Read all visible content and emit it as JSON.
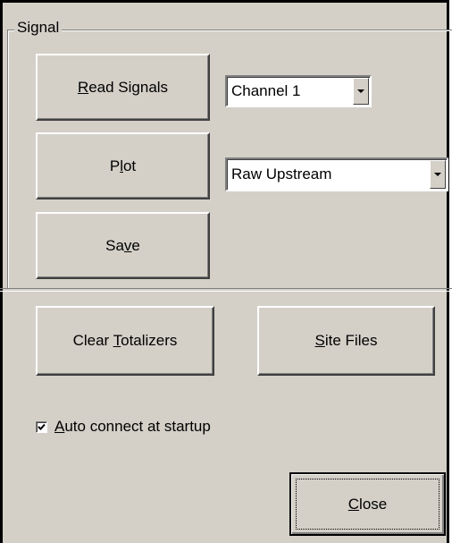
{
  "group": {
    "title": "Signal"
  },
  "buttons": {
    "read_signals": {
      "pre": "",
      "key": "R",
      "post": "ead Signals"
    },
    "plot": {
      "pre": "P",
      "key": "l",
      "post": "ot"
    },
    "save": {
      "pre": "Sa",
      "key": "v",
      "post": "e"
    },
    "clear_totalizers": {
      "pre": "Clear ",
      "key": "T",
      "post": "otalizers"
    },
    "site_files": {
      "pre": "",
      "key": "S",
      "post": "ite Files"
    },
    "close": {
      "pre": "",
      "key": "C",
      "post": "lose"
    }
  },
  "channel_select": {
    "value": "Channel 1"
  },
  "signal_type_select": {
    "value": "Raw Upstream"
  },
  "auto_connect": {
    "checked": true,
    "pre": "",
    "key": "A",
    "post": "uto connect at startup"
  },
  "icons": {
    "dropdown": "chevron-down-icon",
    "check": "checkmark-icon"
  },
  "colors": {
    "window_bg": "#d4d0c8",
    "border": "#000000"
  }
}
